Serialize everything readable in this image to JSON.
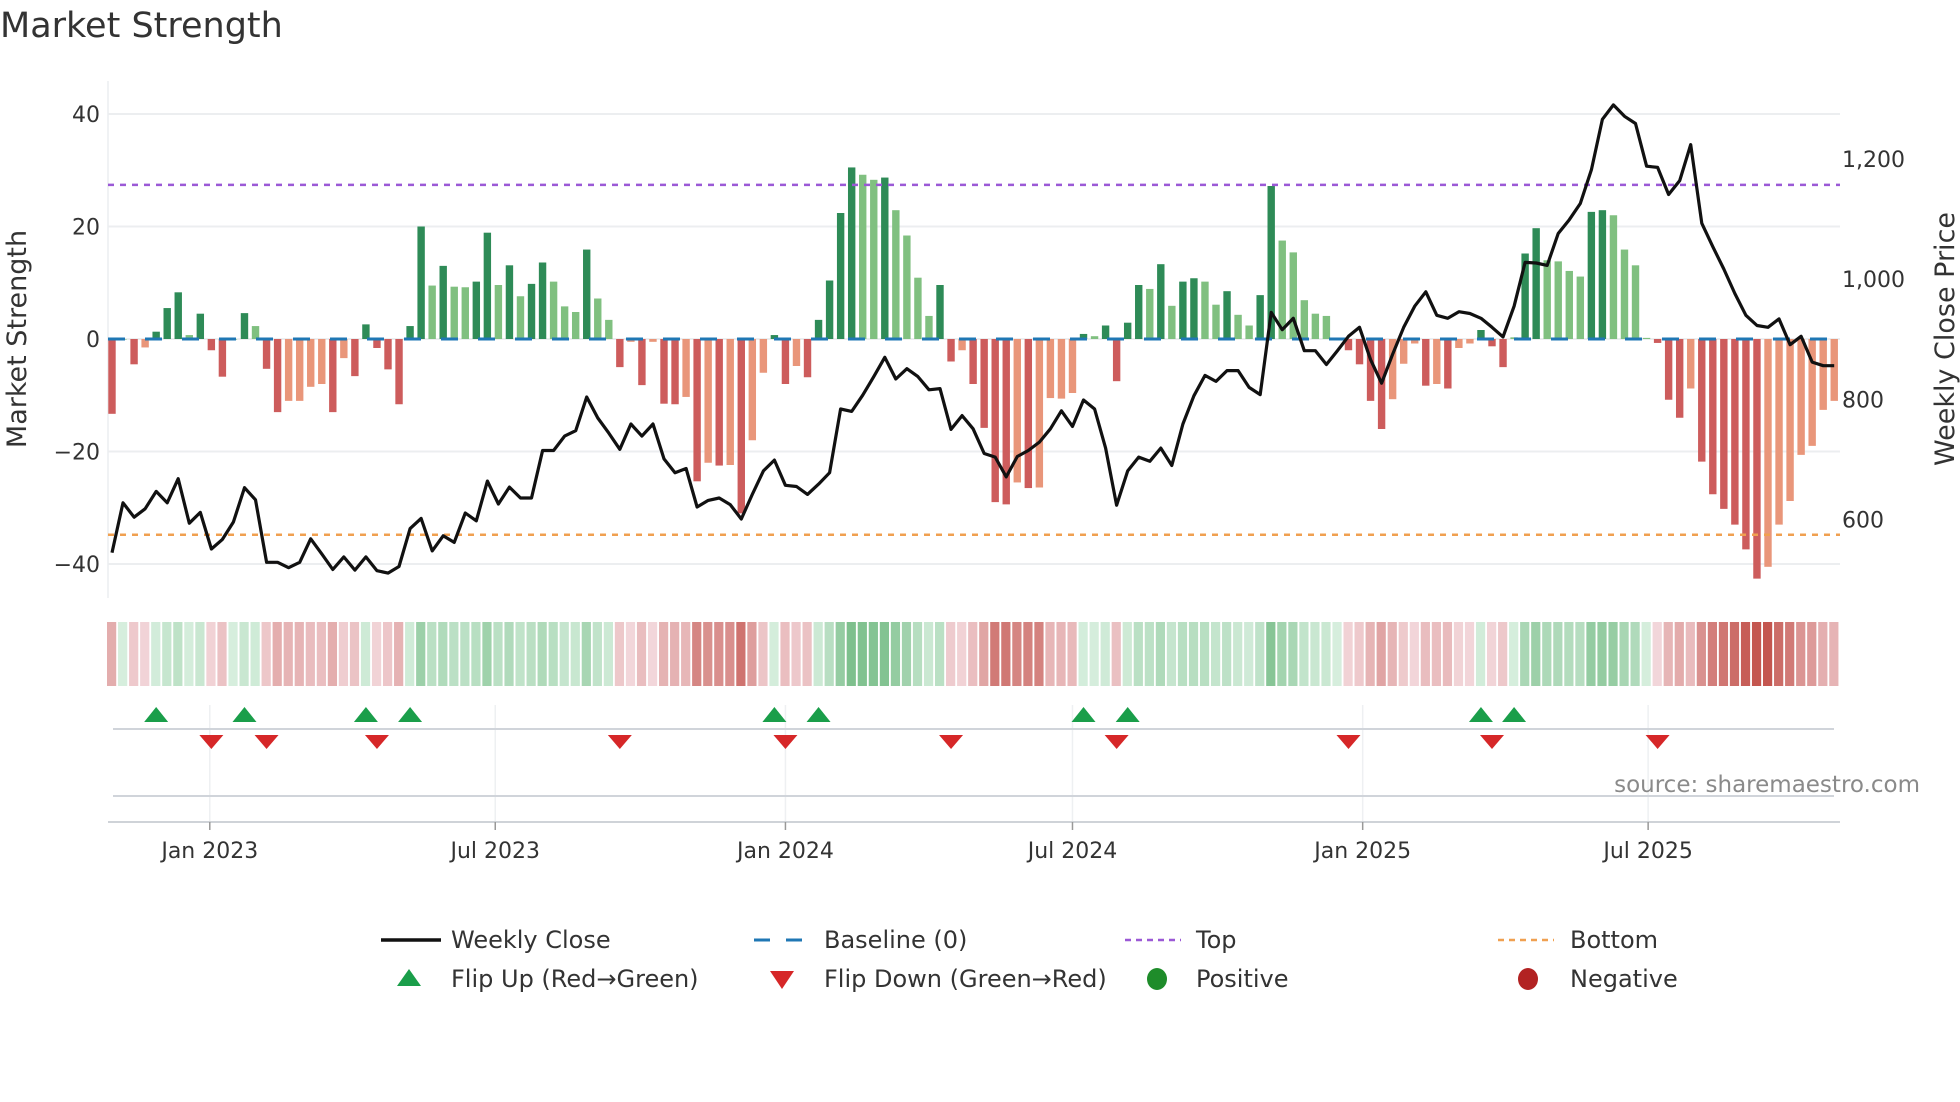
{
  "title": "Market Strength",
  "source": "source: sharemaestro.com",
  "legend": [
    {
      "label": "Weekly Close",
      "icon": "line-solid-black"
    },
    {
      "label": "Baseline (0)",
      "icon": "line-dashed-blue"
    },
    {
      "label": "Top",
      "icon": "line-dotted-purple"
    },
    {
      "label": "Bottom",
      "icon": "line-dotted-orange"
    },
    {
      "label": "Flip Up (Red→Green)",
      "icon": "triangle-up-green"
    },
    {
      "label": "Flip Down (Green→Red)",
      "icon": "triangle-down-red"
    },
    {
      "label": "Positive",
      "icon": "circle-green"
    },
    {
      "label": "Negative",
      "icon": "circle-red"
    }
  ],
  "chart_data": {
    "type": "bar",
    "title": "Market Strength",
    "ylabel": "Market Strength",
    "y2label": "Weekly Close Price",
    "ylim": [
      -46,
      45
    ],
    "y2lim": [
      470,
      1330
    ],
    "grid": true,
    "legend_position": "bottom",
    "x_start_date": "2022-10-31",
    "x_interval_days": 7,
    "yticks": [
      {
        "value": 40,
        "label": "40"
      },
      {
        "value": 20,
        "label": "20"
      },
      {
        "value": 0,
        "label": "0"
      },
      {
        "value": -20,
        "label": "−20"
      },
      {
        "value": -40,
        "label": "−40"
      }
    ],
    "y2ticks": [
      {
        "value": 1200,
        "label": "1,200"
      },
      {
        "value": 1000,
        "label": "1,000"
      },
      {
        "value": 800,
        "label": "800"
      },
      {
        "value": 600,
        "label": "600"
      }
    ],
    "xticks": [
      {
        "date": "2023-01-01",
        "label": "Jan 2023"
      },
      {
        "date": "2023-07-01",
        "label": "Jul 2023"
      },
      {
        "date": "2024-01-01",
        "label": "Jan 2024"
      },
      {
        "date": "2024-07-01",
        "label": "Jul 2024"
      },
      {
        "date": "2025-01-01",
        "label": "Jan 2025"
      },
      {
        "date": "2025-07-01",
        "label": "Jul 2025"
      }
    ],
    "reference_lines": {
      "top": 27.4,
      "bottom": -34.8,
      "baseline": 0
    },
    "series": [
      {
        "name": "Market Strength",
        "type": "bar",
        "values": [
          -13.3,
          0,
          -4.5,
          -1.5,
          1.3,
          5.5,
          8.3,
          0.7,
          4.5,
          -2,
          -6.7,
          0,
          4.6,
          2.3,
          -5.3,
          -13,
          -11,
          -11,
          -8.5,
          -8,
          -13,
          -3.4,
          -6.6,
          2.6,
          -1.6,
          -5.4,
          -11.6,
          2.3,
          20,
          9.5,
          13,
          9.3,
          9.2,
          10.2,
          18.9,
          9.6,
          13.1,
          7.6,
          9.8,
          13.6,
          10.2,
          5.8,
          4.8,
          15.9,
          7.2,
          3.4,
          -5,
          -0.5,
          -8.2,
          -0.5,
          -11.5,
          -11.6,
          -10.3,
          -25.3,
          -22,
          -22.5,
          -22.4,
          -31,
          -18,
          -6,
          0.7,
          -8,
          -4.8,
          -6.8,
          3.4,
          10.4,
          22.4,
          30.5,
          29.2,
          28.3,
          28.7,
          22.9,
          18.4,
          10.9,
          4.1,
          9.6,
          -4,
          -2,
          -8,
          -15.8,
          -29,
          -29.4,
          -25.5,
          -26.5,
          -26.4,
          -10.5,
          -10.6,
          -9.6,
          0.9,
          0.5,
          2.4,
          -7.5,
          2.9,
          9.6,
          8.9,
          13.3,
          5.9,
          10.2,
          10.8,
          10.2,
          6.1,
          8.5,
          4.3,
          2.4,
          7.8,
          27.2,
          17.5,
          15.4,
          6.9,
          4.5,
          4.1,
          0,
          -2,
          -4.5,
          -11,
          -16,
          -10.7,
          -4.4,
          -0.8,
          -8.3,
          -8,
          -8.8,
          -1.6,
          -0.8,
          1.6,
          -1.3,
          -5,
          0.3,
          15.2,
          19.7,
          14,
          13.8,
          12.1,
          11.1,
          22.6,
          22.9,
          22,
          15.9,
          13.1,
          0.2,
          -0.7,
          -10.8,
          -14,
          -8.8,
          -21.8,
          -27.6,
          -30.2,
          -33,
          -37.4,
          -42.6,
          -40.5,
          -33,
          -28.8,
          -20.6,
          -19,
          -12.6,
          -11
        ],
        "shade": "DLDLDDDLDDDLDLDDLLLLDLDDDDDDDLDLLDDLDLDDLLLDLLDLDLDDLDLDLDLLDDLDDDDDLLDLLLLDDLDDDDLDLLLLDLDDDDLDLDDLLDLLDDLLLLLLDDDDLLLDLDLLDDDLDDLLLLDDLLLLDDDLDDDDDDLLLLLLL"
      },
      {
        "name": "Weekly Close",
        "type": "line",
        "axis": "right",
        "values": [
          545,
          628,
          604,
          618,
          647,
          628,
          668,
          594,
          612,
          551,
          567,
          596,
          653,
          633,
          529,
          529,
          520,
          529,
          568,
          543,
          517,
          538,
          516,
          538,
          515,
          511,
          522,
          585,
          602,
          548,
          573,
          562,
          611,
          598,
          664,
          626,
          654,
          636,
          636,
          715,
          715,
          739,
          748,
          804,
          769,
          744,
          717,
          759,
          739,
          759,
          701,
          678,
          685,
          621,
          632,
          636,
          625,
          601,
          642,
          681,
          699,
          657,
          655,
          642,
          659,
          678,
          784,
          780,
          807,
          838,
          870,
          834,
          851,
          838,
          816,
          818,
          750,
          773,
          751,
          710,
          704,
          671,
          705,
          715,
          729,
          751,
          781,
          755,
          799,
          784,
          719,
          624,
          681,
          704,
          697,
          719,
          690,
          759,
          806,
          840,
          830,
          848,
          848,
          820,
          808,
          945,
          916,
          935,
          881,
          881,
          858,
          881,
          905,
          920,
          866,
          827,
          875,
          920,
          955,
          979,
          940,
          935,
          946,
          943,
          935,
          920,
          904,
          955,
          1028,
          1027,
          1023,
          1076,
          1099,
          1126,
          1182,
          1266,
          1290,
          1271,
          1259,
          1188,
          1186,
          1141,
          1164,
          1224,
          1093,
          1054,
          1017,
          976,
          940,
          923,
          920,
          934,
          891,
          905,
          862,
          856,
          856
        ]
      }
    ],
    "flips_up_week_index": [
      4,
      12,
      23,
      27,
      60,
      64,
      88,
      92,
      124,
      127
    ],
    "flips_down_week_index": [
      9,
      14,
      24,
      46,
      61,
      76,
      91,
      112,
      125,
      140
    ],
    "colors": {
      "positive_strong": "#2e8b57",
      "positive_weak": "#80c080",
      "negative_strong": "#cd5c5c",
      "negative_weak": "#e9967a",
      "close": "#111111",
      "baseline": "#1f77b4",
      "top": "#9b59d6",
      "bottom": "#f0a050",
      "flip_up": "#1a9e4a",
      "flip_down": "#d62728",
      "positive_dot": "#1e8c2a",
      "negative_dot": "#b22222"
    }
  }
}
